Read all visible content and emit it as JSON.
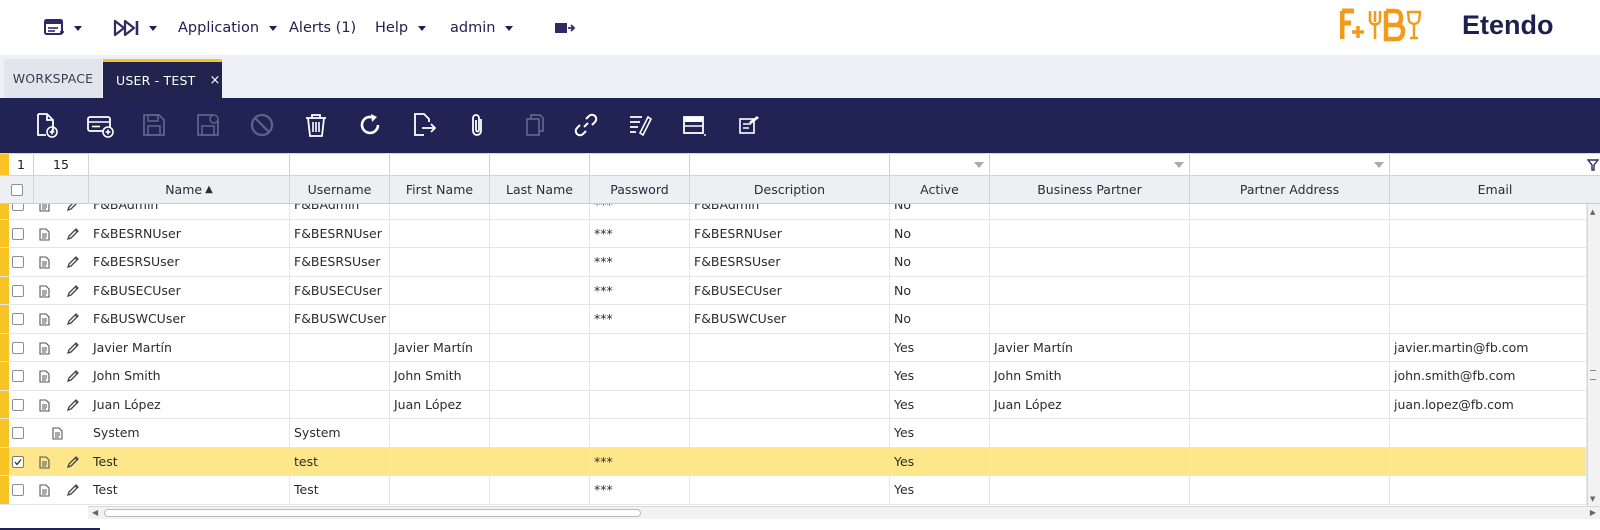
{
  "nav": {
    "application": "Application",
    "alerts": "Alerts (1)",
    "help": "Help",
    "user": "admin"
  },
  "brand": {
    "logo_text": "F+B",
    "name": "Etendo"
  },
  "tabs": [
    {
      "label": "WORKSPACE"
    },
    {
      "label": "USER - TEST",
      "close": "×"
    }
  ],
  "toolbar_icons": [
    "new-record-icon",
    "new-row-icon",
    "save-icon",
    "save-close-icon",
    "undo-icon",
    "delete-icon",
    "refresh-icon",
    "export-icon",
    "attachment-icon",
    "clone-icon",
    "link-icon",
    "audit-icon",
    "grid-view-icon",
    "notes-icon"
  ],
  "grid": {
    "selection_count": "1",
    "total_count": "15",
    "sort_indicator": "▲",
    "columns": [
      "Name",
      "Username",
      "First Name",
      "Last Name",
      "Password",
      "Description",
      "Active",
      "Business Partner",
      "Partner Address",
      "Email"
    ],
    "rows": [
      {
        "name": "F&BAdmin",
        "username": "F&BAdmin",
        "first_name": "",
        "last_name": "",
        "password": "***",
        "description": "F&BAdmin",
        "active": "No",
        "business_partner": "",
        "partner_address": "",
        "email": ""
      },
      {
        "name": "F&BESRNUser",
        "username": "F&BESRNUser",
        "first_name": "",
        "last_name": "",
        "password": "***",
        "description": "F&BESRNUser",
        "active": "No",
        "business_partner": "",
        "partner_address": "",
        "email": ""
      },
      {
        "name": "F&BESRSUser",
        "username": "F&BESRSUser",
        "first_name": "",
        "last_name": "",
        "password": "***",
        "description": "F&BESRSUser",
        "active": "No",
        "business_partner": "",
        "partner_address": "",
        "email": ""
      },
      {
        "name": "F&BUSECUser",
        "username": "F&BUSECUser",
        "first_name": "",
        "last_name": "",
        "password": "***",
        "description": "F&BUSECUser",
        "active": "No",
        "business_partner": "",
        "partner_address": "",
        "email": ""
      },
      {
        "name": "F&BUSWCUser",
        "username": "F&BUSWCUser",
        "first_name": "",
        "last_name": "",
        "password": "***",
        "description": "F&BUSWCUser",
        "active": "No",
        "business_partner": "",
        "partner_address": "",
        "email": ""
      },
      {
        "name": "Javier Martín",
        "username": "",
        "first_name": "Javier Martín",
        "last_name": "",
        "password": "",
        "description": "",
        "active": "Yes",
        "business_partner": "Javier Martín",
        "partner_address": "",
        "email": "javier.martin@fb.com"
      },
      {
        "name": "John Smith",
        "username": "",
        "first_name": "John Smith",
        "last_name": "",
        "password": "",
        "description": "",
        "active": "Yes",
        "business_partner": "John Smith",
        "partner_address": "",
        "email": "john.smith@fb.com"
      },
      {
        "name": "Juan López",
        "username": "",
        "first_name": "Juan López",
        "last_name": "",
        "password": "",
        "description": "",
        "active": "Yes",
        "business_partner": "Juan López",
        "partner_address": "",
        "email": "juan.lopez@fb.com"
      },
      {
        "name": "System",
        "username": "System",
        "first_name": "",
        "last_name": "",
        "password": "",
        "description": "",
        "active": "Yes",
        "business_partner": "",
        "partner_address": "",
        "email": "",
        "no_edit": true
      },
      {
        "name": "Test",
        "username": "test",
        "first_name": "",
        "last_name": "",
        "password": "***",
        "description": "",
        "active": "Yes",
        "business_partner": "",
        "partner_address": "",
        "email": "",
        "selected": true
      },
      {
        "name": "Test",
        "username": "Test",
        "first_name": "",
        "last_name": "",
        "password": "***",
        "description": "",
        "active": "Yes",
        "business_partner": "",
        "partner_address": "",
        "email": ""
      }
    ]
  },
  "colors": {
    "navy": "#202353",
    "accent": "#f7c325",
    "selected_row": "#fde78a",
    "brand_orange": "#f29a1b"
  }
}
